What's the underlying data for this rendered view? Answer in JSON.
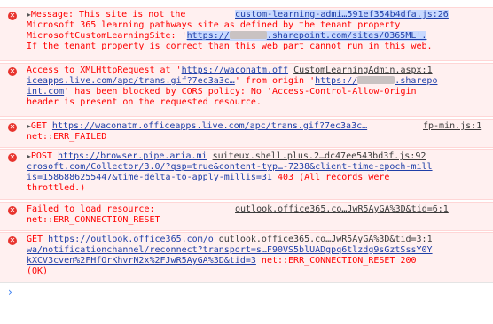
{
  "messages": [
    {
      "id": "m1",
      "type": "error",
      "expanded": false,
      "lines": [
        "Message: This site is not the",
        "Microsoft 365 learning pathways site as defined by the tenant property",
        "MicrosoftCustomLearningSite: '",
        ".sharepoint.com/sites/O365ML'.",
        "If the tenant property is correct than this web part cannot run in this web."
      ],
      "url_prefix": "https://",
      "source": "custom-learning-admi…591ef354b4dfa.js:26"
    },
    {
      "id": "m2",
      "type": "error",
      "lines": [
        "Access to XMLHttpRequest at '",
        "https://waconatm.off",
        "iceapps.live.com/apc/trans.gif?7ec3a3c…",
        "' from origin '",
        "https://",
        ".sharepo",
        "int.com",
        "' has been blocked by CORS policy: No 'Access-Control-Allow-Origin'",
        "header is present on the requested resource."
      ],
      "source": "CustomLearningAdmin.aspx:1"
    },
    {
      "id": "m3",
      "type": "error",
      "expanded": false,
      "method": "GET",
      "url": "https://waconatm.officeapps.live.com/apc/trans.gif?7ec3a3c…",
      "status": "net::ERR_FAILED",
      "source": "fp-min.js:1"
    },
    {
      "id": "m4",
      "type": "error",
      "expanded": false,
      "method": "POST",
      "url_line1": "https://browser.pipe.aria.mi",
      "url_line2": "crosoft.com/Collector/3.0/?qsp=true&content-typ…-7238&client-time-epoch-mill",
      "url_line3": "is=1586886255447&time-delta-to-apply-millis=31",
      "status_tail": "403 (All records were",
      "status_line4": "throttled.)",
      "source": "suiteux.shell.plus.2…dc47ee543bd3f.js:92"
    },
    {
      "id": "m5",
      "type": "error",
      "line1": "Failed to load resource:",
      "line2": "net::ERR_CONNECTION_RESET",
      "source": "outlook.office365.co…JwR5AyGA%3D&tid=6:1"
    },
    {
      "id": "m6",
      "type": "error",
      "method": "GET",
      "url_line1": "https://outlook.office365.com/o",
      "url_line2": "wa/notificationchannel/reconnect?transport=s…F90VS5blUADgpq6tlzdg9sGztSssY0Y",
      "url_line3": "kXCV3cven%2FHfOrKhvrN2x%2FJwR5AyGA%3D&tid=3",
      "status_tail": "net::ERR_CONNECTION_RESET 200",
      "status_line4": "(OK)",
      "source": "outlook.office365.co…JwR5AyGA%3D&tid=3:1"
    }
  ],
  "icons": {
    "error": "error-circle-icon",
    "expand": "expand-triangle-icon",
    "prompt": "console-prompt-icon"
  },
  "prompt_glyph": "›",
  "colors": {
    "error_text": "#fe0000",
    "link": "#1f3fa8",
    "error_bg": "#fff0f0",
    "prompt": "#367cf1"
  }
}
